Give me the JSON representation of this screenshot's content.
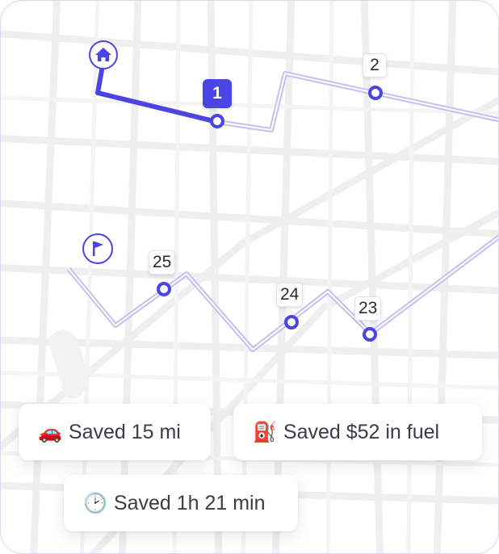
{
  "stops": [
    {
      "label": "1",
      "active": true
    },
    {
      "label": "2",
      "active": false
    },
    {
      "label": "25",
      "active": false
    },
    {
      "label": "24",
      "active": false
    },
    {
      "label": "23",
      "active": false
    }
  ],
  "markers": {
    "start": "home-icon",
    "finish": "flag-icon"
  },
  "savings": {
    "distance": {
      "icon": "🚗",
      "text": "Saved 15 mi"
    },
    "fuel": {
      "icon": "⛽",
      "text": "Saved $52 in fuel"
    },
    "time": {
      "icon": "🕑",
      "text": "Saved 1h 21 min"
    }
  },
  "colors": {
    "route_active": "#4b45e6",
    "route_planned": "#b9b6f3",
    "road": "#efefef",
    "card_border": "#d9d6f2"
  }
}
